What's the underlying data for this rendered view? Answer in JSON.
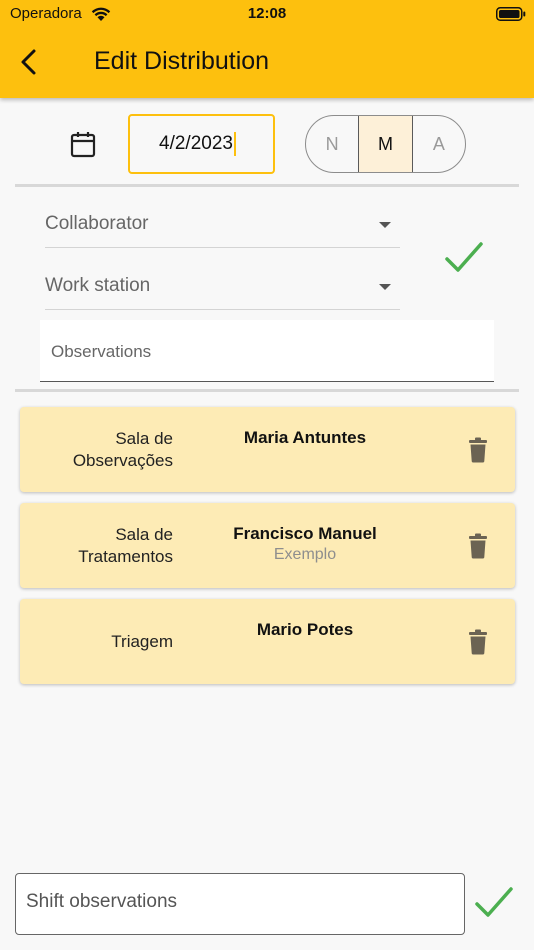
{
  "status_bar": {
    "carrier": "Operadora",
    "time": "12:08"
  },
  "header": {
    "title": "Edit Distribution"
  },
  "date": {
    "value": "4/2/2023"
  },
  "shift_toggle": {
    "options": [
      "N",
      "M",
      "A"
    ],
    "selected": "M"
  },
  "form": {
    "collaborator_label": "Collaborator",
    "workstation_label": "Work station",
    "observations_placeholder": "Observations"
  },
  "distributions": [
    {
      "station_line1": "Sala de",
      "station_line2": "Observações",
      "person": "Maria Antuntes",
      "note": ""
    },
    {
      "station_line1": "Sala de",
      "station_line2": "Tratamentos",
      "person": "Francisco Manuel",
      "note": "Exemplo"
    },
    {
      "station_line1": "Triagem",
      "station_line2": "",
      "person": "Mario Potes",
      "note": ""
    }
  ],
  "footer": {
    "shift_observations_placeholder": "Shift observations"
  },
  "colors": {
    "accent": "#fdc00e",
    "card": "#fdebb5",
    "check": "#4caf50"
  }
}
